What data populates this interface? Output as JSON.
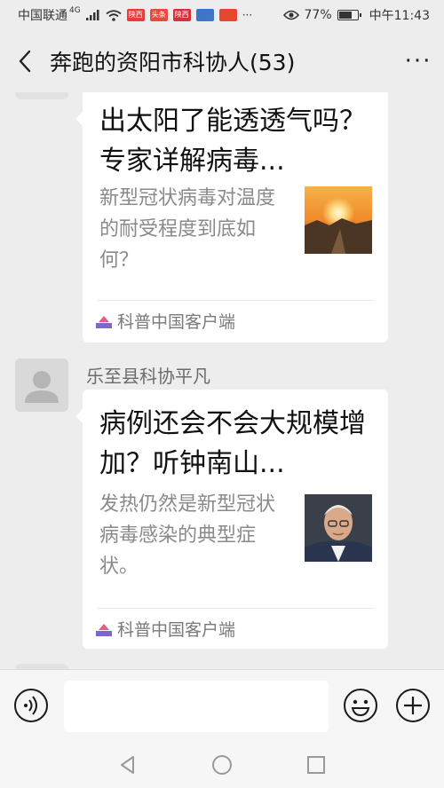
{
  "status_bar": {
    "carrier": "中国联通",
    "network": "4G",
    "app_badges": [
      {
        "label": "陕西",
        "color": "#e63c3c"
      },
      {
        "label": "头条",
        "color": "#e74b3c"
      },
      {
        "label": "陕西",
        "color": "#d6313c"
      },
      {
        "label": "",
        "color": "#3b77c6"
      },
      {
        "label": "",
        "color": "#e8452f"
      }
    ],
    "battery": "77%",
    "battery_level": 0.77,
    "time": "中午11:43"
  },
  "header": {
    "title": "奔跑的资阳市科协人(53)",
    "more": "···"
  },
  "messages": [
    {
      "sender": "",
      "title": "出太阳了能透透气吗？专家详解病毒...",
      "description": "新型冠状病毒对温度的耐受程度到底如何？",
      "thumbnail": "sunset-over-city",
      "source": "科普中国客户端"
    },
    {
      "sender": "乐至县科协平凡",
      "title": "病例还会不会大规模增加？听钟南山...",
      "description": "发热仍然是新型冠状病毒感染的典型症状。",
      "thumbnail": "elderly-man-portrait",
      "source": "科普中国客户端"
    }
  ],
  "input_bar": {
    "placeholder": ""
  },
  "colors": {
    "background": "#ededed",
    "card": "#ffffff",
    "source_logo": "#7b68c8"
  }
}
